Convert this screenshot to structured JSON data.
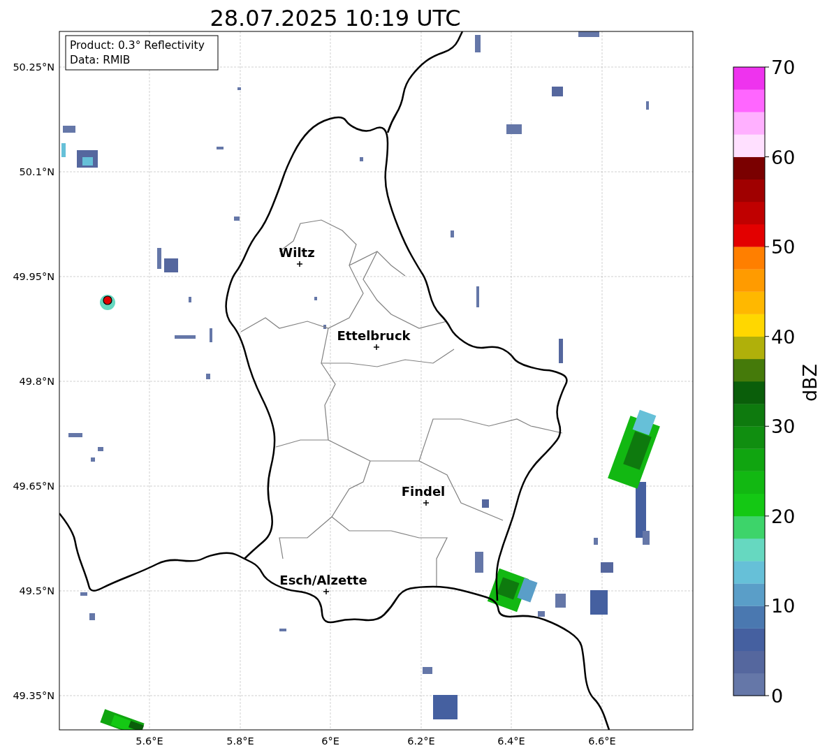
{
  "title": "28.07.2025 10:19 UTC",
  "info_box": [
    "Product: 0.3° Reflectivity",
    "Data: RMIB"
  ],
  "y_ticks": [
    "50.25°N",
    "50.1°N",
    "49.95°N",
    "49.8°N",
    "49.65°N",
    "49.5°N",
    "49.35°N"
  ],
  "x_ticks": [
    "5.6°E",
    "5.8°E",
    "6°E",
    "6.2°E",
    "6.4°E",
    "6.6°E"
  ],
  "cities": [
    {
      "name": "Wiltz"
    },
    {
      "name": "Ettelbruck"
    },
    {
      "name": "Findel"
    },
    {
      "name": "Esch/Alzette"
    }
  ],
  "colorbar": {
    "label": "dBZ",
    "ticks": [
      "70",
      "60",
      "50",
      "40",
      "30",
      "20",
      "10",
      "0"
    ],
    "levels": [
      {
        "color": "#6577a8"
      },
      {
        "color": "#55679e"
      },
      {
        "color": "#4560a0"
      },
      {
        "color": "#4a78b0"
      },
      {
        "color": "#5a9ec8"
      },
      {
        "color": "#66c0d8"
      },
      {
        "color": "#66d8c0"
      },
      {
        "color": "#3dd46a"
      },
      {
        "color": "#14c814"
      },
      {
        "color": "#12b812"
      },
      {
        "color": "#10a510"
      },
      {
        "color": "#108e10"
      },
      {
        "color": "#0e7a0e"
      },
      {
        "color": "#0a5e0a"
      },
      {
        "color": "#457a0a"
      },
      {
        "color": "#b0b00a"
      },
      {
        "color": "#ffd700"
      },
      {
        "color": "#ffb800"
      },
      {
        "color": "#ff9b00"
      },
      {
        "color": "#ff7f00"
      },
      {
        "color": "#e30000"
      },
      {
        "color": "#c00000"
      },
      {
        "color": "#a00000"
      },
      {
        "color": "#7a0000"
      },
      {
        "color": "#ffe0ff"
      },
      {
        "color": "#ffb0ff"
      },
      {
        "color": "#ff66ff"
      },
      {
        "color": "#ee33ee"
      }
    ]
  }
}
